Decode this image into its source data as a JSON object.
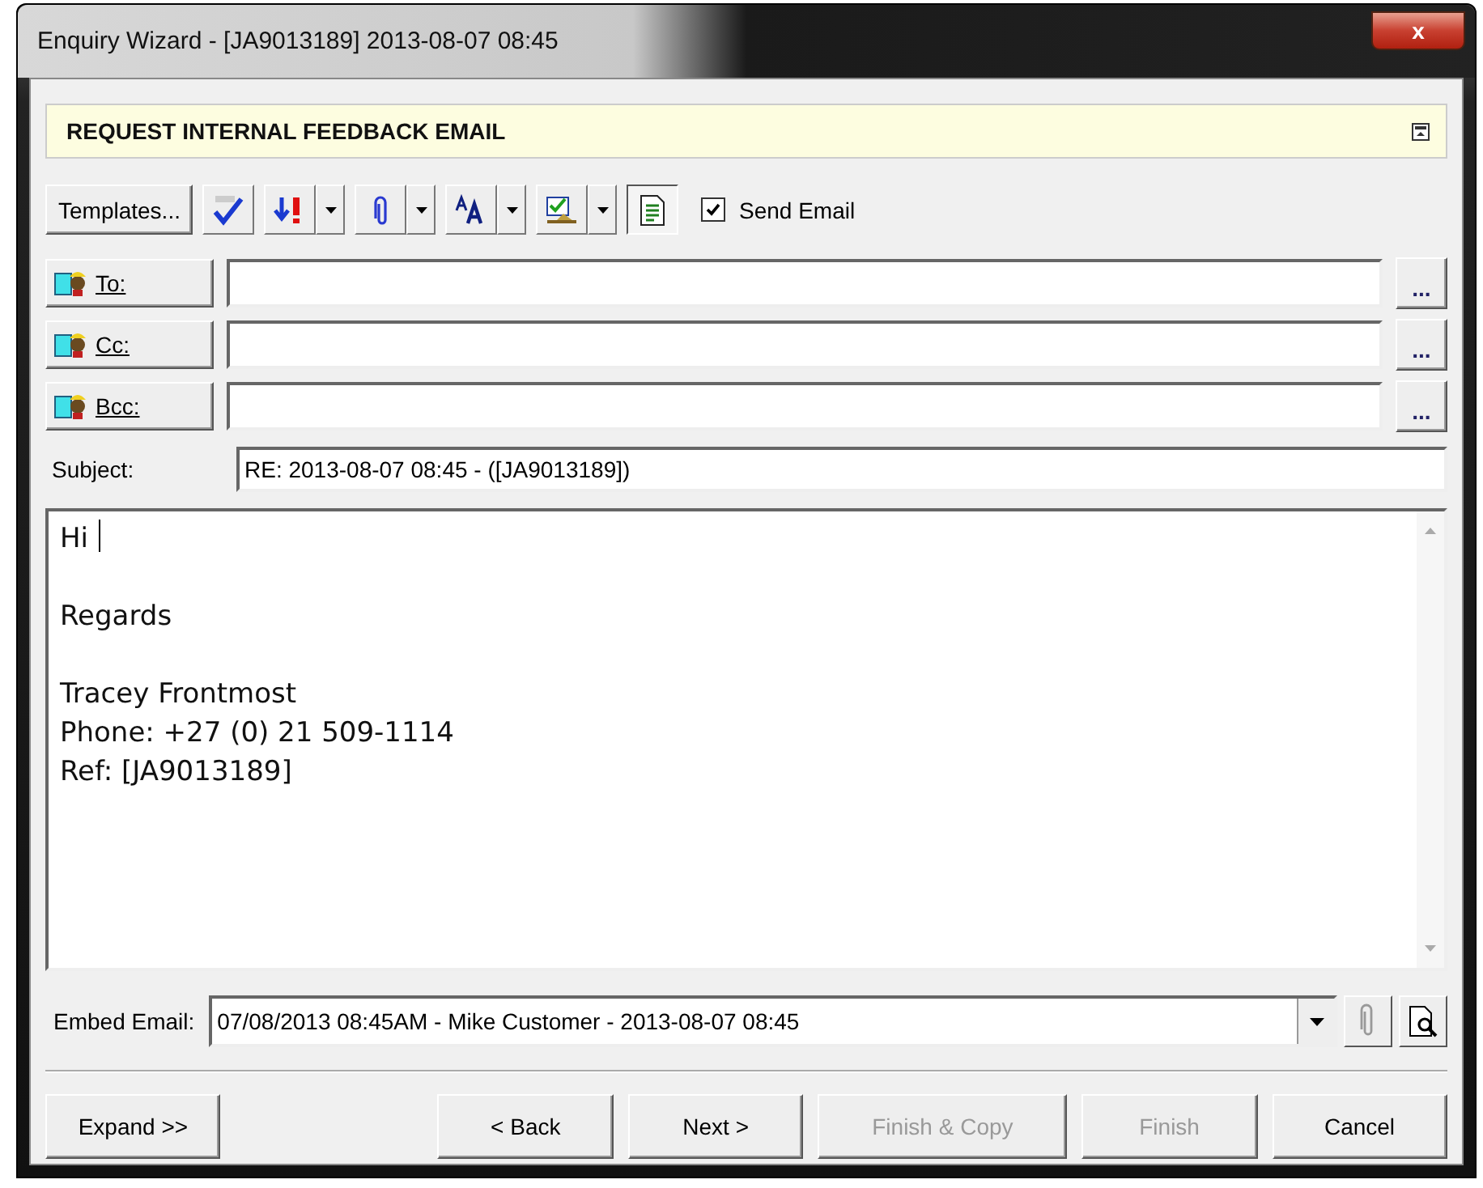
{
  "window": {
    "title": "Enquiry Wizard - [JA9013189] 2013-08-07 08:45",
    "close": "x"
  },
  "header": {
    "title": "REQUEST INTERNAL FEEDBACK EMAIL"
  },
  "toolbar": {
    "templates": "Templates...",
    "send_email": {
      "label": "Send Email",
      "checked": true
    }
  },
  "recipients": [
    {
      "label": "To:",
      "more": "..."
    },
    {
      "label": "Cc:",
      "more": "..."
    },
    {
      "label": "Bcc:",
      "more": "..."
    }
  ],
  "subject": {
    "label": "Subject:",
    "value": "RE: 2013-08-07 08:45 - ([JA9013189])"
  },
  "body": {
    "paragraphs": [
      [
        "Hi"
      ],
      [
        "Regards"
      ],
      [
        "Tracey Frontmost",
        "Phone: +27 (0) 21 509-1114",
        "Ref: [JA9013189]"
      ]
    ]
  },
  "embed": {
    "label": "Embed Email:",
    "value": "07/08/2013 08:45AM - Mike Customer - 2013-08-07 08:45"
  },
  "buttons": [
    {
      "label": "Expand >>",
      "disabled": false
    },
    {
      "label": "< Back",
      "disabled": false
    },
    {
      "label": "Next >",
      "disabled": false
    },
    {
      "label": "Finish & Copy",
      "disabled": true
    },
    {
      "label": "Finish",
      "disabled": true
    },
    {
      "label": "Cancel",
      "disabled": false
    }
  ]
}
